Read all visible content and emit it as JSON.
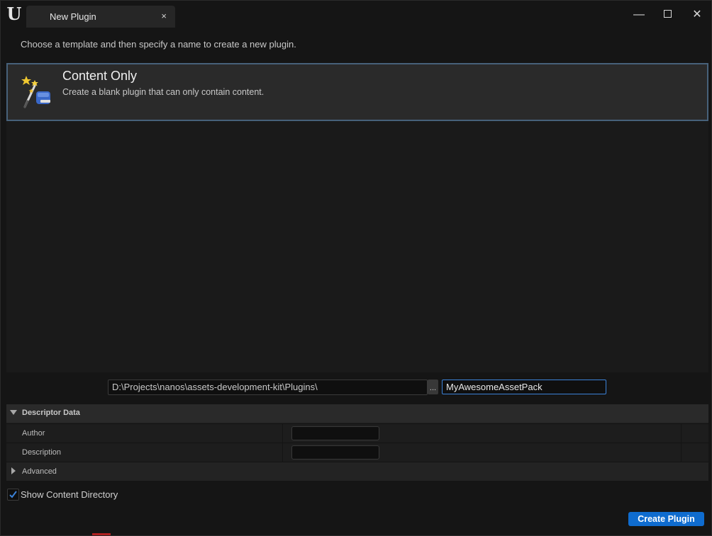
{
  "window": {
    "logo_text": "U",
    "tab_title": "New Plugin",
    "tab_close": "×",
    "minimize": "—",
    "close": "✕"
  },
  "instructions": "Choose a template and then specify a name to create a new plugin.",
  "templates": [
    {
      "name": "Content Only",
      "description": "Create a blank plugin that can only contain content.",
      "icon": "magic-wand-icon",
      "selected": true
    }
  ],
  "path": {
    "value": "D:\\Projects\\nanos\\assets-development-kit\\Plugins\\",
    "browse_label": "...",
    "plugin_name": "MyAwesomeAssetPack"
  },
  "descriptor": {
    "header": "Descriptor Data",
    "author_label": "Author",
    "author_value": "",
    "description_label": "Description",
    "description_value": "",
    "advanced_label": "Advanced"
  },
  "show_content_directory": {
    "label": "Show Content Directory",
    "checked": true
  },
  "create_button": "Create Plugin",
  "colors": {
    "accent": "#0f6ccf",
    "selection_border": "#47617a",
    "focus_border": "#3b82d8"
  }
}
